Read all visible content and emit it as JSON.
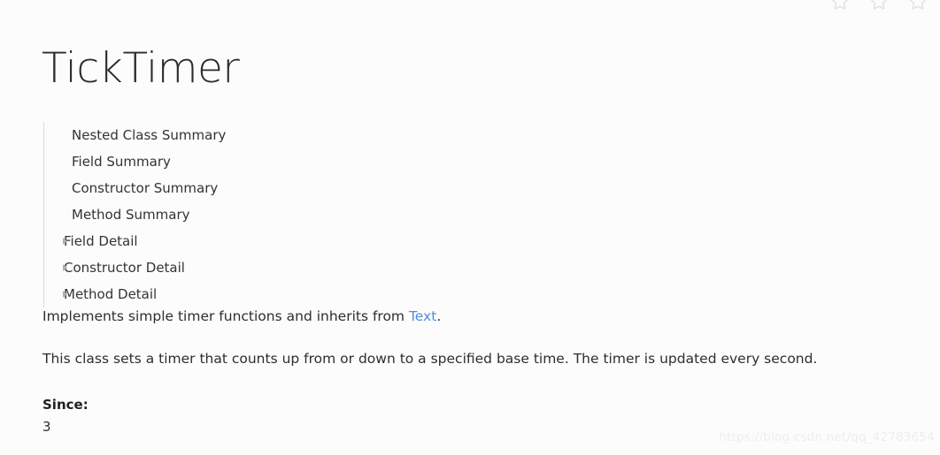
{
  "header": {
    "title": "TickTimer",
    "star_icons": [
      {
        "name": "star-outline-icon-1"
      },
      {
        "name": "star-outline-icon-2"
      },
      {
        "name": "star-outline-icon-3"
      }
    ]
  },
  "toc": {
    "items": [
      {
        "label": "Nested Class Summary",
        "marker": false
      },
      {
        "label": "Field Summary",
        "marker": false
      },
      {
        "label": "Constructor Summary",
        "marker": false
      },
      {
        "label": "Method Summary",
        "marker": false
      },
      {
        "label": "Field Detail",
        "marker": true
      },
      {
        "label": "Constructor Detail",
        "marker": true
      },
      {
        "label": "Method Detail",
        "marker": true
      }
    ]
  },
  "content": {
    "intro_before_link": "Implements simple timer functions and inherits from ",
    "intro_link": "Text",
    "intro_after_link": ".",
    "description": "This class sets a timer that counts up from or down to a specified base time. The timer is updated every second.",
    "since_label": "Since:",
    "since_value": "3"
  },
  "watermark": {
    "text": "https://blog.csdn.net/qq_42783654"
  },
  "colors": {
    "background": "#fcfcfc",
    "title": "#2b2b2b",
    "body_text": "#2e2e2e",
    "toc_text": "#333333",
    "link": "#4a90d9",
    "toc_rule": "#dcdcdc",
    "marker": "#b0b0b0",
    "watermark": "#eeeeee",
    "star_icon": "#e2e2e4"
  }
}
